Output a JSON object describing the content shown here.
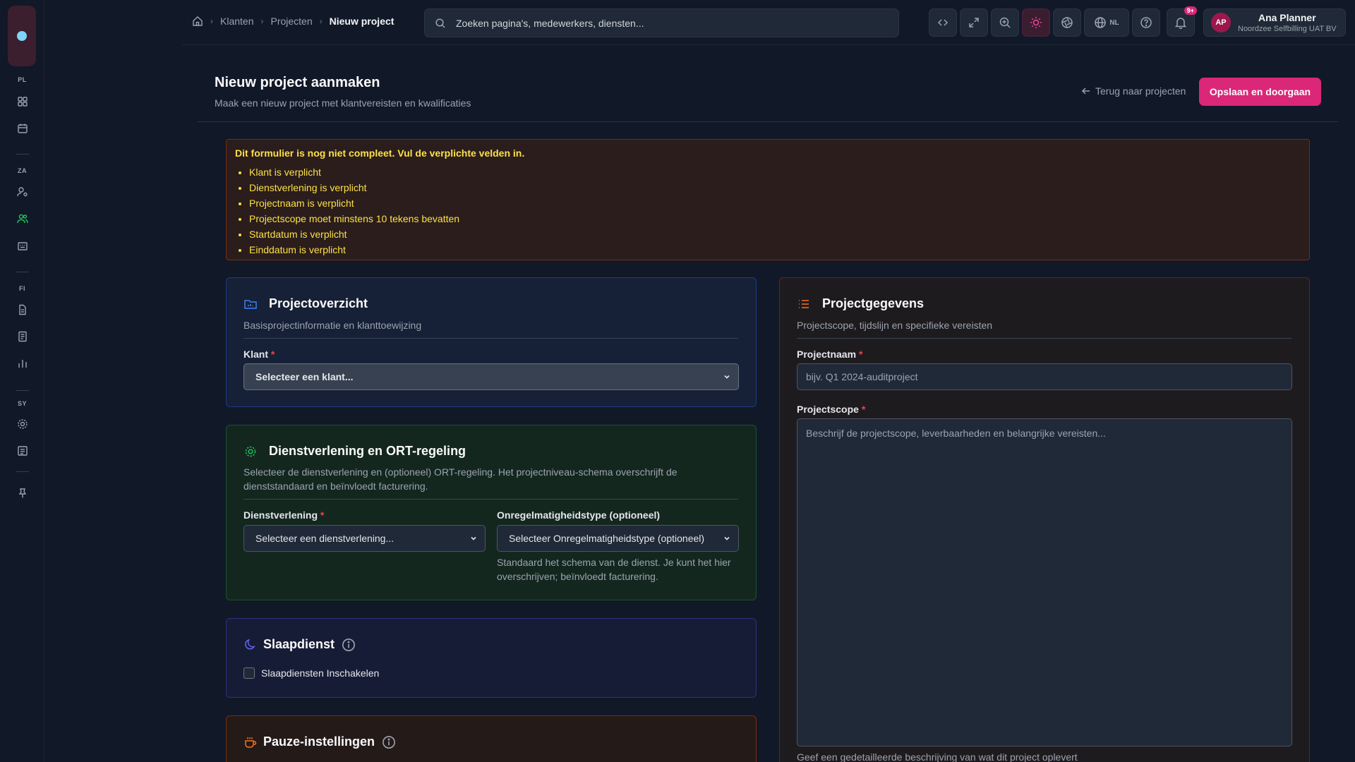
{
  "sidebar": {
    "sections": [
      "PL",
      "ZA",
      "FI",
      "SY"
    ]
  },
  "breadcrumb": {
    "items": [
      "Klanten",
      "Projecten"
    ],
    "current": "Nieuw project"
  },
  "search": {
    "placeholder": "Zoeken pagina's, medewerkers, diensten..."
  },
  "topbar": {
    "language": "NL",
    "notifications_badge": "9+"
  },
  "user": {
    "initials": "AP",
    "name": "Ana Planner",
    "org": "Noordzee Selfbilling UAT BV"
  },
  "page": {
    "title": "Nieuw project aanmaken",
    "subtitle": "Maak een nieuw project met klantvereisten en kwalificaties",
    "back_label": "Terug naar projecten",
    "save_label": "Opslaan en doorgaan"
  },
  "errors": {
    "title": "Dit formulier is nog niet compleet. Vul de verplichte velden in.",
    "items": [
      "Klant is verplicht",
      "Dienstverlening is verplicht",
      "Projectnaam is verplicht",
      "Projectscope moet minstens 10 tekens bevatten",
      "Startdatum is verplicht",
      "Einddatum is verplicht"
    ]
  },
  "overview": {
    "title": "Projectoverzicht",
    "description": "Basisprojectinformatie en klanttoewijzing",
    "client_label": "Klant",
    "client_value": "Selecteer een klant..."
  },
  "service": {
    "title": "Dienstverlening en ORT-regeling",
    "description_line1": "Selecteer de dienstverlening en (optioneel) ORT-regeling. Het projectniveau-schema overschrijft de",
    "description_line2": "dienststandaard en beïnvloedt facturering.",
    "service_label": "Dienstverlening",
    "service_value": "Selecteer een dienstverlening...",
    "irregular_label": "Onregelmatigheidstype (optioneel)",
    "irregular_value": "Selecteer Onregelmatigheidstype (optioneel)",
    "help_line1": "Standaard het schema van de dienst. Je kunt het hier",
    "help_line2": "overschrijven; beïnvloedt facturering."
  },
  "sleep": {
    "title": "Slaapdienst",
    "checkbox_label": "Slaapdiensten Inschakelen"
  },
  "pause": {
    "title": "Pauze-instellingen"
  },
  "details": {
    "title": "Projectgegevens",
    "description": "Projectscope, tijdslijn en specifieke vereisten",
    "name_label": "Projectnaam",
    "name_placeholder": "bijv. Q1 2024-auditproject",
    "scope_label": "Projectscope",
    "scope_placeholder": "Beschrijf de projectscope, leverbaarheden en belangrijke vereisten...",
    "scope_help": "Geef een gedetailleerde beschrijving van wat dit project oplevert"
  },
  "colors": {
    "accent": "#db2777",
    "warning_text": "#fde047",
    "required": "#ef4444"
  }
}
